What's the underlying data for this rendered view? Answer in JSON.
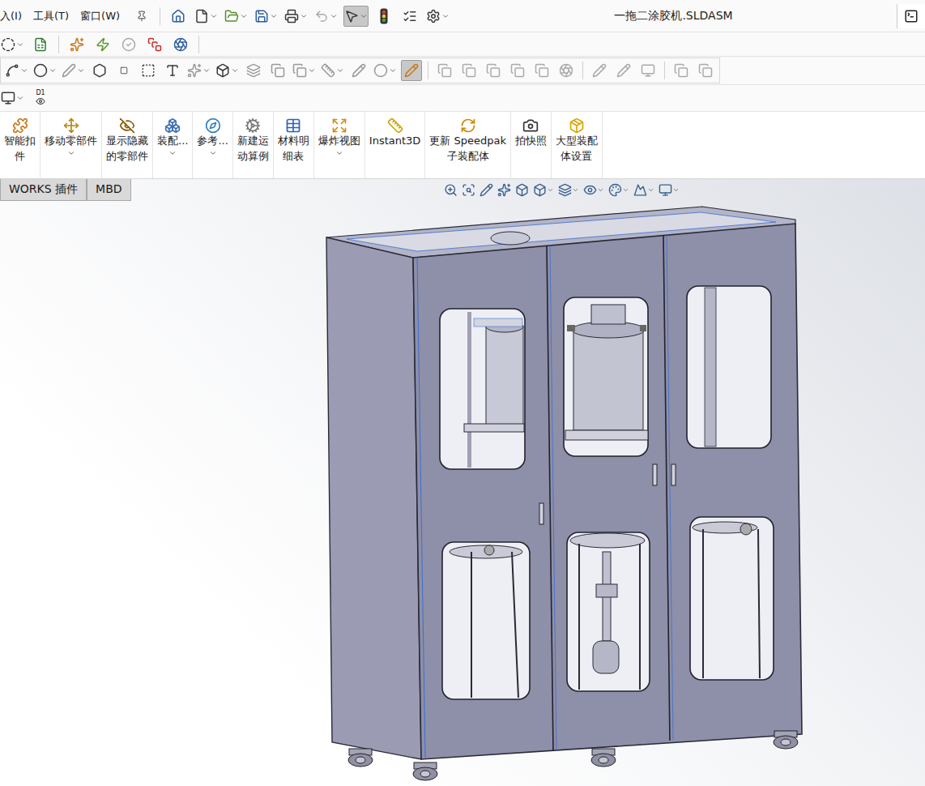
{
  "window": {
    "title": "一拖二涂胶机.SLDASM"
  },
  "menu": [
    {
      "label": "入(I)"
    },
    {
      "label": "工具(T)"
    },
    {
      "label": "窗口(W)"
    }
  ],
  "toolbar_state": {
    "select_active": true,
    "sketch_edit_active": true
  },
  "display_toolbar": {
    "dimension_label": "D1"
  },
  "command_manager": [
    {
      "lines": [
        "智能扣",
        "件"
      ],
      "dropdown": false
    },
    {
      "lines": [
        "移动零部件"
      ],
      "dropdown": true
    },
    {
      "lines": [
        "显示隐藏",
        "的零部件"
      ],
      "dropdown": false
    },
    {
      "lines": [
        "装配..."
      ],
      "dropdown": true
    },
    {
      "lines": [
        "参考..."
      ],
      "dropdown": true
    },
    {
      "lines": [
        "新建运",
        "动算例"
      ],
      "dropdown": false
    },
    {
      "lines": [
        "材料明",
        "细表"
      ],
      "dropdown": false
    },
    {
      "lines": [
        "爆炸视图"
      ],
      "dropdown": true
    },
    {
      "lines": [
        "Instant3D"
      ],
      "dropdown": false
    },
    {
      "lines": [
        "更新 Speedpak",
        "子装配体"
      ],
      "dropdown": false
    },
    {
      "lines": [
        "拍快照"
      ],
      "dropdown": false
    },
    {
      "lines": [
        "大型装配",
        "体设置"
      ],
      "dropdown": false
    }
  ],
  "tabs": [
    {
      "label": "WORKS 插件",
      "selected": false
    },
    {
      "label": "MBD",
      "selected": false
    }
  ]
}
